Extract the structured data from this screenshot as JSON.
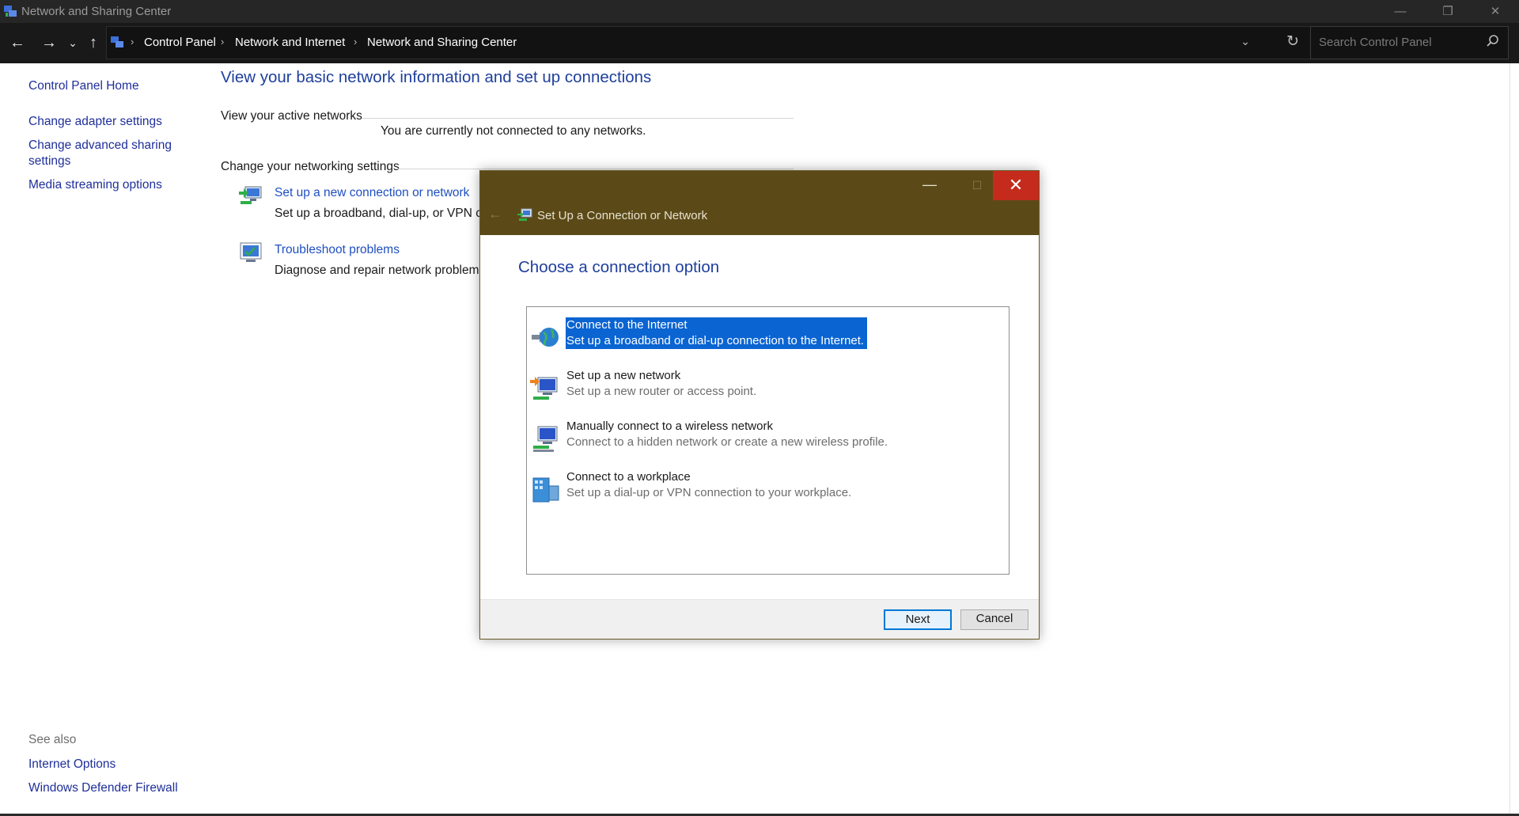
{
  "window": {
    "title": "Network and Sharing Center"
  },
  "address_bar": {
    "crumbs": [
      "Control Panel",
      "Network and Internet",
      "Network and Sharing Center"
    ],
    "search_placeholder": "Search Control Panel"
  },
  "left_pane": {
    "home": "Control Panel Home",
    "links": [
      "Change adapter settings",
      "Change advanced sharing",
      "settings",
      "Media streaming options"
    ],
    "see_also_label": "See also",
    "see_also": [
      "Internet Options",
      "Windows Defender Firewall"
    ]
  },
  "main": {
    "title": "View your basic network information and set up connections",
    "active_networks_label": "View your active networks",
    "not_connected": "You are currently not connected to any networks.",
    "change_settings_label": "Change your networking settings",
    "tasks": [
      {
        "link": "Set up a new connection or network",
        "desc": "Set up a broadband, dial-up, or VPN co"
      },
      {
        "link": "Troubleshoot problems",
        "desc": "Diagnose and repair network problems"
      }
    ]
  },
  "dialog": {
    "title": "Set Up a Connection or Network",
    "heading": "Choose a connection option",
    "options": [
      {
        "title": "Connect to the Internet",
        "desc": "Set up a broadband or dial-up connection to the Internet.",
        "selected": true,
        "icon": "globe-icon"
      },
      {
        "title": "Set up a new network",
        "desc": "Set up a new router or access point.",
        "selected": false,
        "icon": "new-network-icon"
      },
      {
        "title": "Manually connect to a wireless network",
        "desc": "Connect to a hidden network or create a new wireless profile.",
        "selected": false,
        "icon": "wireless-icon"
      },
      {
        "title": "Connect to a workplace",
        "desc": "Set up a dial-up or VPN connection to your workplace.",
        "selected": false,
        "icon": "workplace-icon"
      }
    ],
    "next_label": "Next",
    "cancel_label": "Cancel"
  },
  "colors": {
    "accent": "#0078d7",
    "selection": "#0a64d2",
    "dialog_titlebar": "#5b4a18",
    "link": "#1f4fc0"
  }
}
